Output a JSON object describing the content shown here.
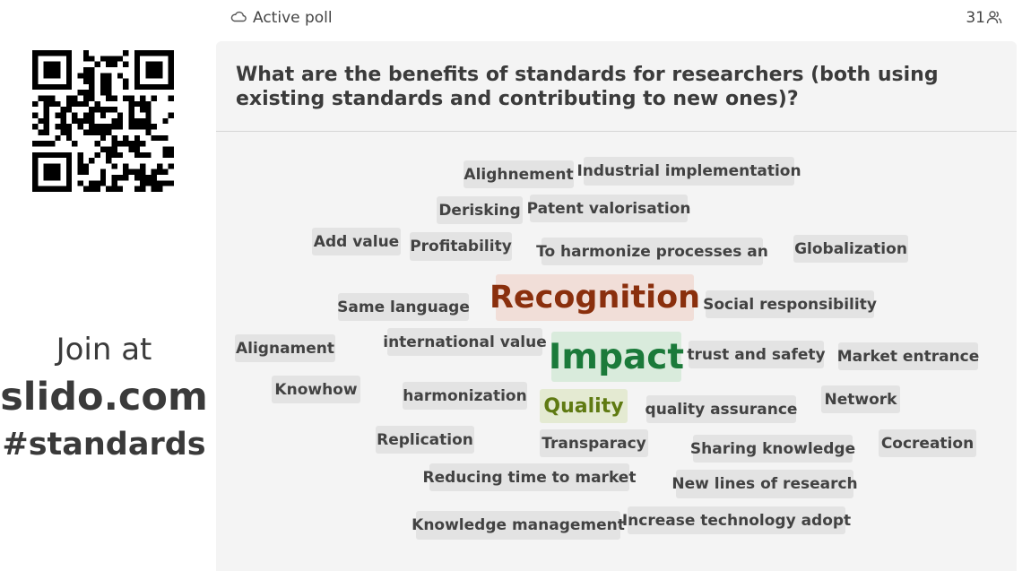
{
  "join": {
    "text": "Join at",
    "domain": "slido.com",
    "code": "#standards"
  },
  "header": {
    "status": "Active poll",
    "status_icon": "cloud-icon",
    "participants": "31",
    "participants_icon": "people-icon"
  },
  "poll": {
    "question": "What are the benefits of standards for researchers (both using existing standards and contributing to new ones)?"
  },
  "colors": {
    "card_bg": "#f4f4f4",
    "word_bg": "#e3e3e3",
    "recognition": "#8a2f0d",
    "impact": "#1b7a3a",
    "quality": "#5f7a12"
  },
  "words": [
    "Alighnement",
    "Industrial implementation",
    "Derisking",
    "Patent valorisation",
    "Add value",
    "Profitability",
    "To harmonize processes an",
    "Globalization",
    "Same language",
    "Recognition",
    "Social responsibility",
    "Alignament",
    "international value",
    "Impact",
    "trust and safety",
    "Market entrance",
    "Knowhow",
    "harmonization",
    "Quality",
    "quality assurance",
    "Network",
    "Replication",
    "Transparacy",
    "Sharing knowledge",
    "Cocreation",
    "Reducing time to market",
    "New lines of research",
    "Knowledge management",
    "Increase technology adopt"
  ]
}
